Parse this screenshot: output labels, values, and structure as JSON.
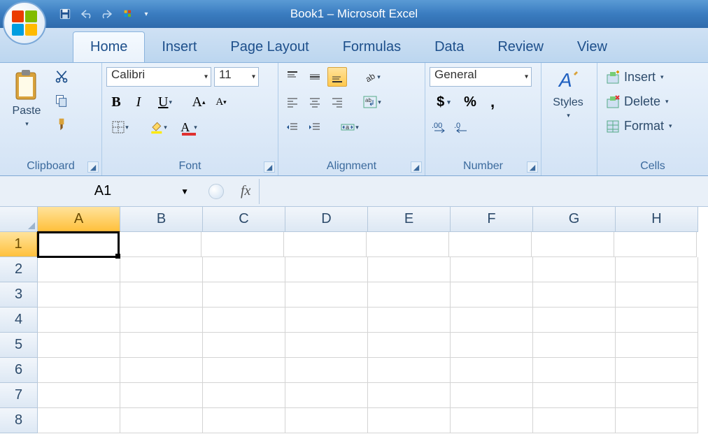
{
  "title": "Book1 – Microsoft Excel",
  "tabs": [
    "Home",
    "Insert",
    "Page Layout",
    "Formulas",
    "Data",
    "Review",
    "View"
  ],
  "active_tab": 0,
  "clipboard": {
    "label": "Clipboard",
    "paste": "Paste"
  },
  "font_group": {
    "label": "Font",
    "font_name": "Calibri",
    "font_size": "11",
    "bold": "B",
    "italic": "I",
    "underline": "U"
  },
  "alignment": {
    "label": "Alignment"
  },
  "number": {
    "label": "Number",
    "format": "General",
    "currency": "$",
    "percent": "%",
    "comma": ","
  },
  "styles": {
    "label": "Styles"
  },
  "cells": {
    "label": "Cells",
    "insert": "Insert",
    "delete": "Delete",
    "format": "Format"
  },
  "namebox": "A1",
  "fx": "fx",
  "columns": [
    "A",
    "B",
    "C",
    "D",
    "E",
    "F",
    "G",
    "H"
  ],
  "rows": [
    "1",
    "2",
    "3",
    "4",
    "5",
    "6",
    "7",
    "8"
  ],
  "active_col": 0,
  "active_row": 0
}
